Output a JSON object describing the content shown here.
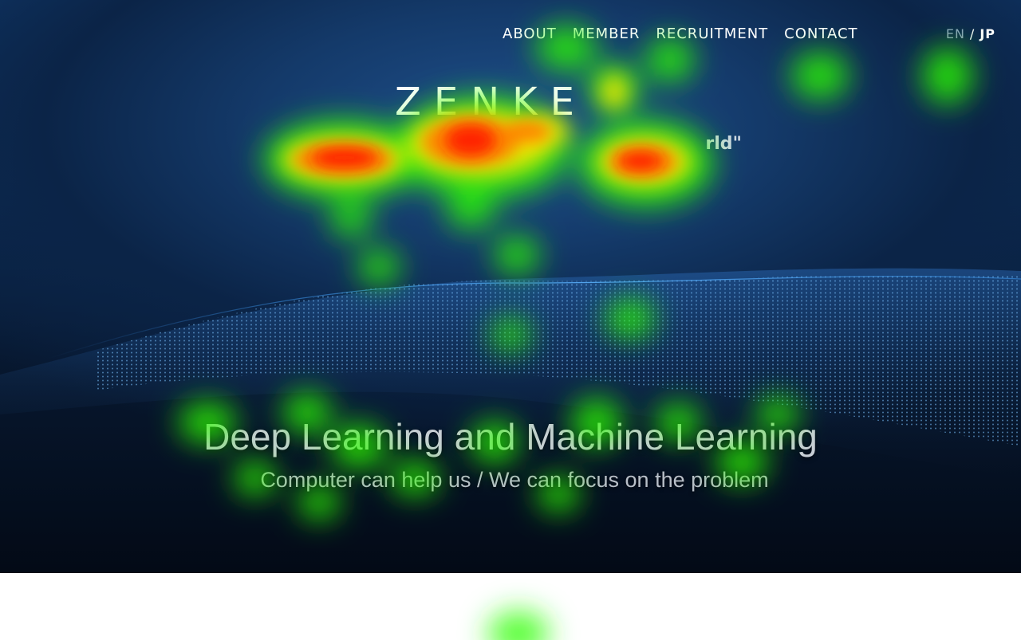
{
  "nav": {
    "items": [
      "ABOUT",
      "MEMBER",
      "RECRUITMENT",
      "CONTACT"
    ]
  },
  "language": {
    "en": "EN",
    "separator": "/",
    "jp": "JP",
    "active": "JP"
  },
  "hero": {
    "logo_text": "ZENKE",
    "tagline_fragment": "rld\"",
    "headline": "Deep Learning and Machine Learning",
    "subheadline": "Computer can help us / We can focus on the problem"
  },
  "overlay": {
    "type": "eye-tracking heatmap",
    "colors": {
      "low": "#2cff00",
      "mid": "#ffe600",
      "high": "#ff1a00"
    }
  },
  "colors": {
    "hero_top": "#103a6e",
    "hero_bottom": "#030a16",
    "page_background": "#ffffff",
    "nav_text": "#ffffff",
    "lang_inactive": "#8fa3c0"
  }
}
